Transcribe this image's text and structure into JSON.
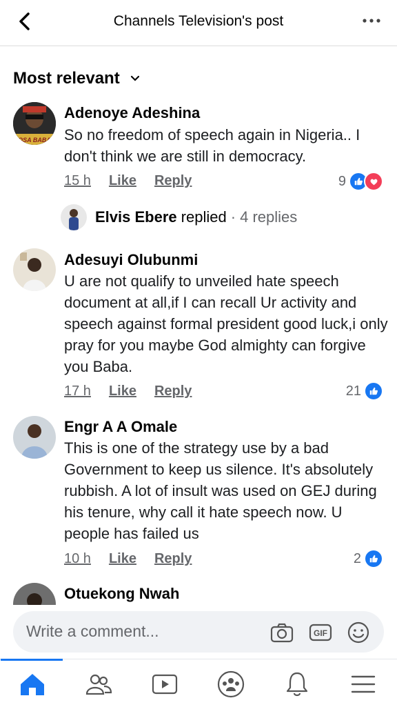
{
  "header": {
    "title": "Channels Television's post"
  },
  "sort": {
    "label": "Most relevant"
  },
  "comments": [
    {
      "name": "Adenoye Adeshina",
      "text": "So no freedom of speech again in Nigeria.. I don't think we are still in democracy.",
      "time": "15 h",
      "like": "Like",
      "reply": "Reply",
      "reactions": "9",
      "avatar_label": "OSA BABA"
    },
    {
      "name": "Adesuyi Olubunmi",
      "text": "U are not qualify to unveiled hate speech document at all,if I can recall Ur activity and speech against formal president good luck,i only pray for you maybe God almighty can forgive you Baba.",
      "time": "17 h",
      "like": "Like",
      "reply": "Reply",
      "reactions": "21"
    },
    {
      "name": "Engr A A Omale",
      "text": "This is one of the strategy use by  a bad Government to keep us silence. It's absolutely rubbish. A lot of insult was used on GEJ during his tenure, why call it hate speech now. U people has failed us",
      "time": "10 h",
      "like": "Like",
      "reply": "Reply",
      "reactions": "2"
    },
    {
      "name": "Otuekong Nwah"
    }
  ],
  "replied": {
    "name": "Elvis Ebere",
    "verb": "replied",
    "count": "· 4 replies"
  },
  "composer": {
    "placeholder": "Write a comment..."
  },
  "colors": {
    "accent": "#1877f2",
    "love": "#f33e58"
  },
  "icons": [
    "back-icon",
    "more-icon",
    "chevron-down-icon",
    "like-icon",
    "love-icon",
    "camera-icon",
    "gif-icon",
    "emoji-icon",
    "home-icon",
    "friends-icon",
    "watch-icon",
    "groups-icon",
    "notifications-icon",
    "menu-icon"
  ]
}
